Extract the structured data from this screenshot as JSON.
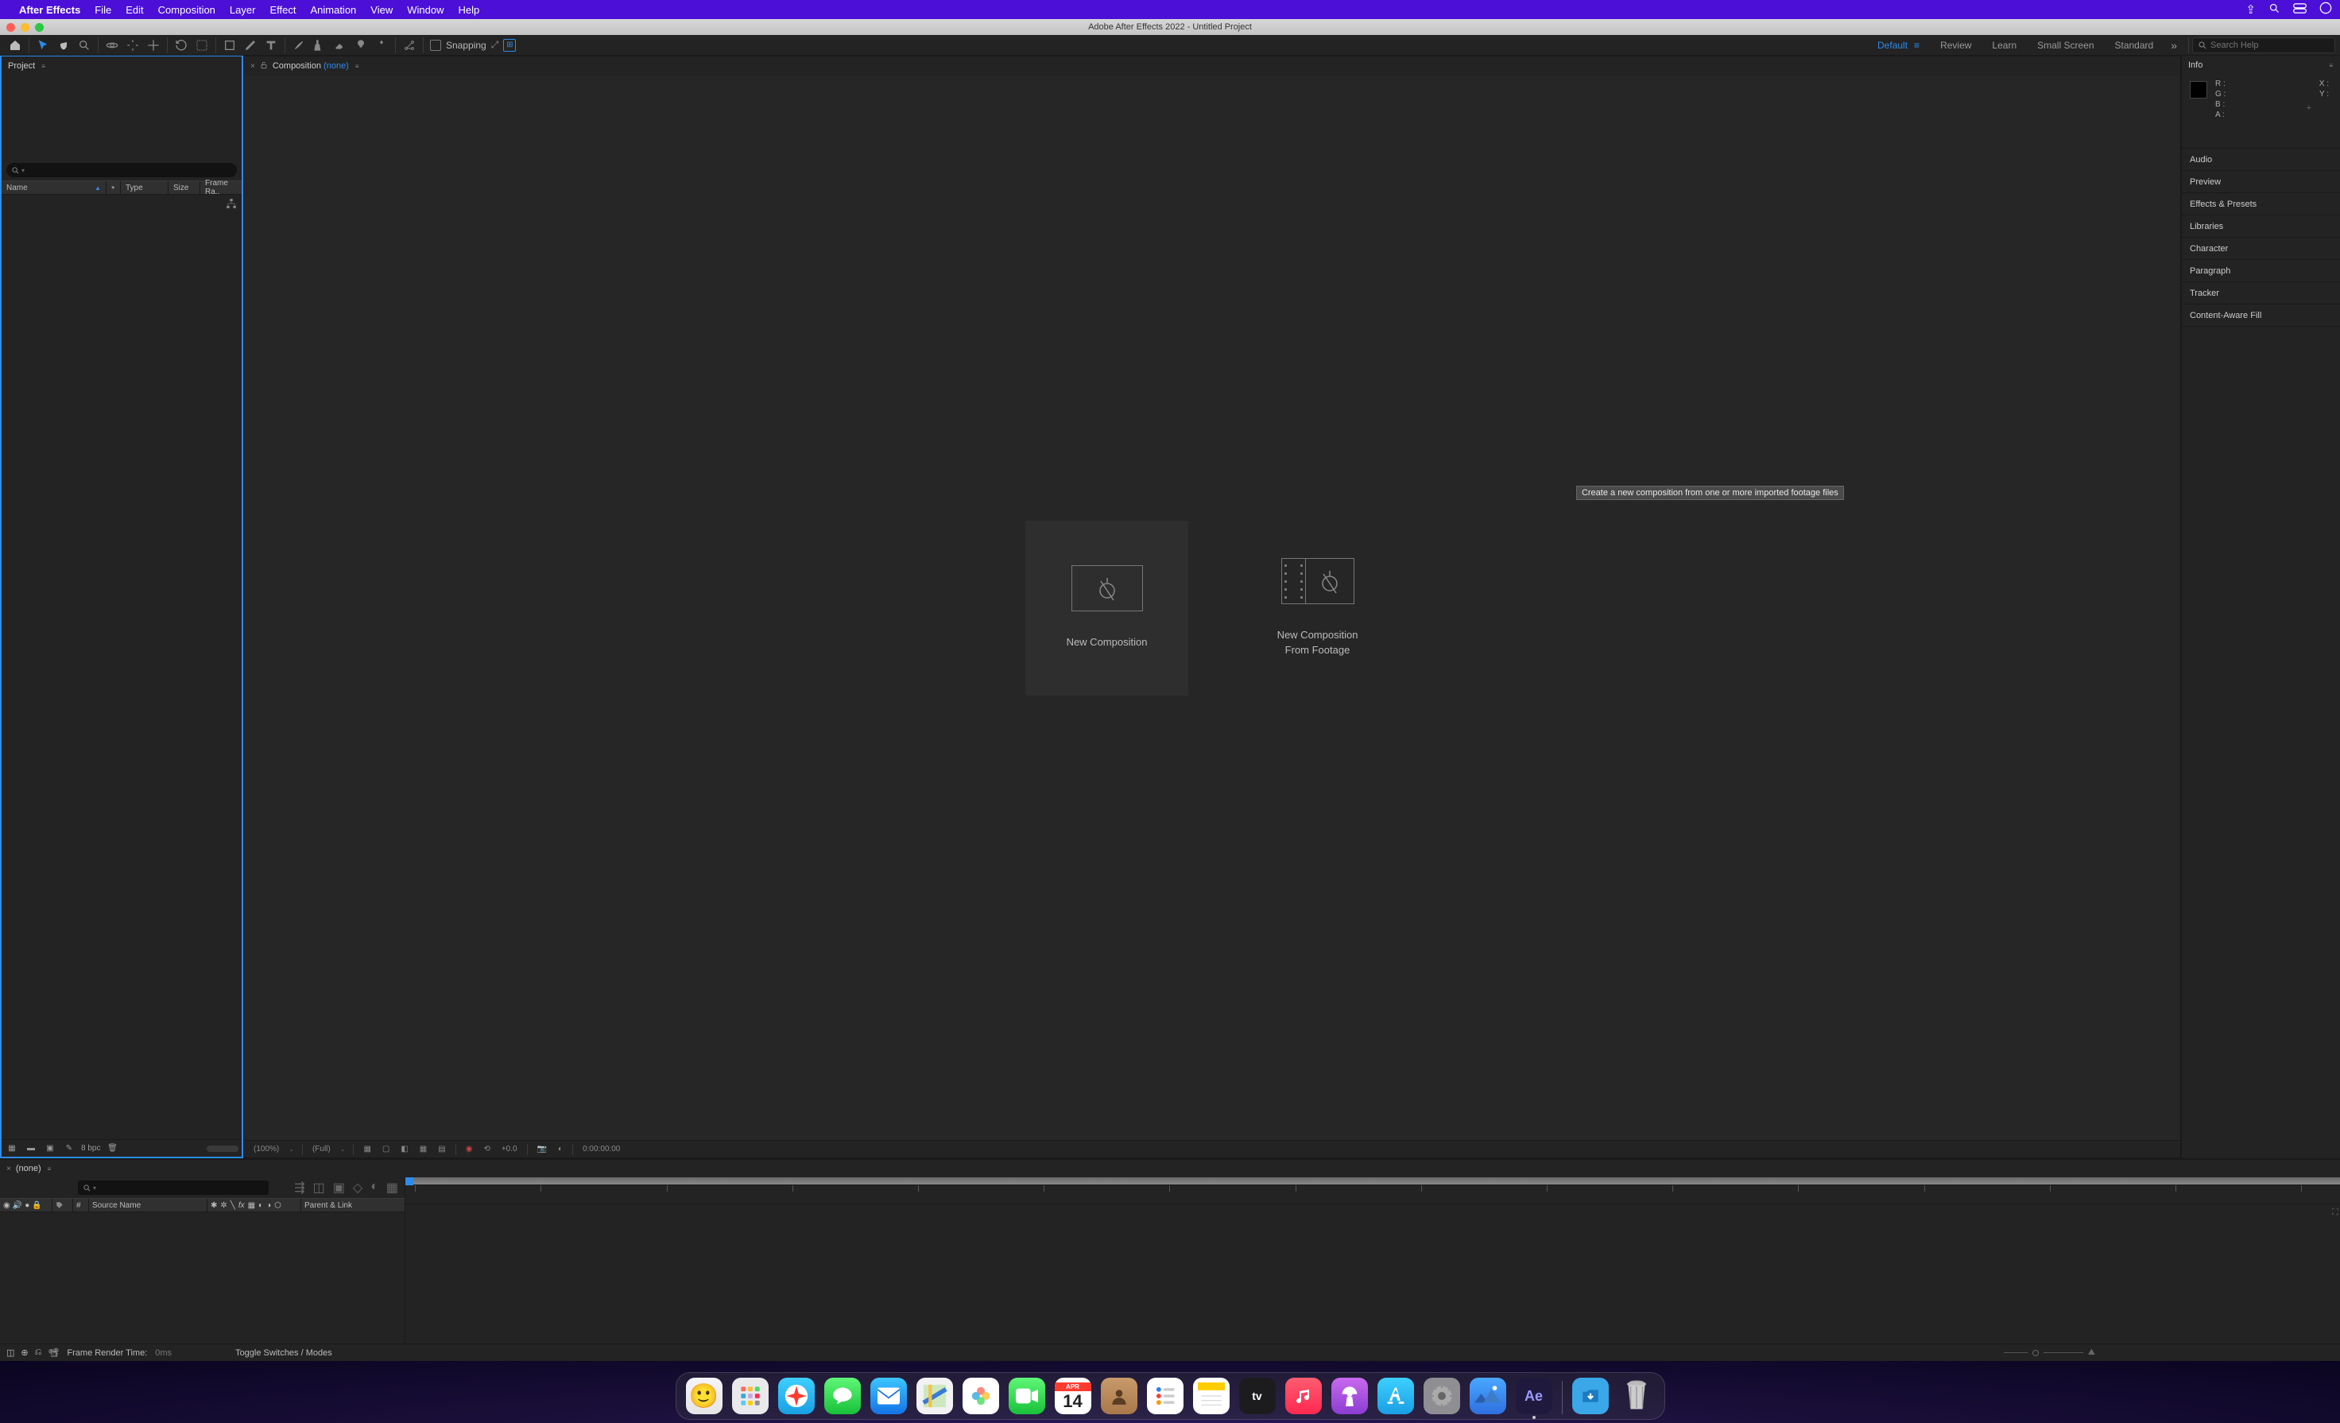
{
  "mac_menu": {
    "app": "After Effects",
    "items": [
      "File",
      "Edit",
      "Composition",
      "Layer",
      "Effect",
      "Animation",
      "View",
      "Window",
      "Help"
    ]
  },
  "window_title": "Adobe After Effects 2022 - Untitled Project",
  "toolbar": {
    "snapping_label": "Snapping",
    "workspaces": [
      "Default",
      "Review",
      "Learn",
      "Small Screen",
      "Standard"
    ],
    "active_workspace": "Default",
    "search_placeholder": "Search Help"
  },
  "project_panel": {
    "title": "Project",
    "columns": {
      "name": "Name",
      "type": "Type",
      "size": "Size",
      "frame": "Frame Ra.."
    },
    "footer_bpc": "8 bpc"
  },
  "composition_panel": {
    "tab_prefix": "Composition",
    "tab_none": "(none)",
    "cards": {
      "new_comp": "New Composition",
      "from_footage_l1": "New Composition",
      "from_footage_l2": "From Footage"
    },
    "tooltip": "Create a new composition from one or more imported footage files",
    "footer": {
      "zoom": "(100%)",
      "res": "(Full)",
      "exposure": "+0.0",
      "timecode": "0:00:00:00"
    }
  },
  "right_panels": {
    "info_title": "Info",
    "info": {
      "R": "R :",
      "G": "G :",
      "B": "B :",
      "A": "A :",
      "X": "X :",
      "Y": "Y :"
    },
    "collapsed": [
      "Audio",
      "Preview",
      "Effects & Presets",
      "Libraries",
      "Character",
      "Paragraph",
      "Tracker",
      "Content-Aware Fill"
    ]
  },
  "timeline": {
    "tab_none": "(none)",
    "col_source": "Source Name",
    "col_parent": "Parent & Link",
    "col_hash": "#",
    "footer": {
      "render_label": "Frame Render Time:",
      "render_value": "0ms",
      "toggle": "Toggle Switches / Modes"
    }
  },
  "dock": {
    "calendar_month": "APR",
    "calendar_day": "14"
  }
}
